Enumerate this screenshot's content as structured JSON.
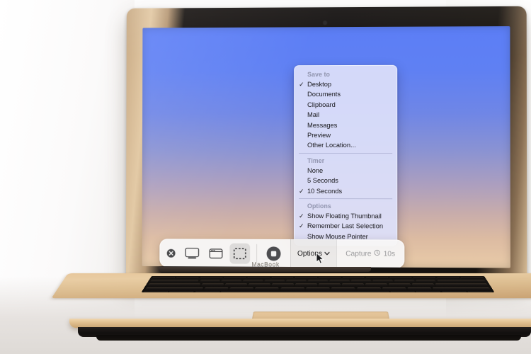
{
  "device": {
    "wordmark": "MacBook",
    "finish_color": "#e0bf94",
    "bezel_color": "#141110"
  },
  "wallpaper": {
    "top_color": "#5c7ef6",
    "bottom_color": "#e8cba9"
  },
  "popover": {
    "sections": [
      {
        "header": "Save to",
        "items": [
          {
            "label": "Desktop",
            "checked": true
          },
          {
            "label": "Documents",
            "checked": false
          },
          {
            "label": "Clipboard",
            "checked": false
          },
          {
            "label": "Mail",
            "checked": false
          },
          {
            "label": "Messages",
            "checked": false
          },
          {
            "label": "Preview",
            "checked": false
          },
          {
            "label": "Other Location...",
            "checked": false
          }
        ]
      },
      {
        "header": "Timer",
        "items": [
          {
            "label": "None",
            "checked": false
          },
          {
            "label": "5 Seconds",
            "checked": false
          },
          {
            "label": "10 Seconds",
            "checked": true
          }
        ]
      },
      {
        "header": "Options",
        "items": [
          {
            "label": "Show Floating Thumbnail",
            "checked": true
          },
          {
            "label": "Remember Last Selection",
            "checked": true
          },
          {
            "label": "Show Mouse Pointer",
            "checked": false
          }
        ]
      }
    ],
    "check_glyph": "✓"
  },
  "toolbar": {
    "close_icon": "close-icon",
    "capture_entire_screen_icon": "capture-entire-screen-icon",
    "capture_window_icon": "capture-selected-window-icon",
    "capture_selection_icon": "capture-selected-portion-icon",
    "record_selected_portion_icon": "record-selected-portion-icon",
    "options_label": "Options",
    "options_chevron": "⌄",
    "capture_label": "Capture",
    "timer_glyph": "◴",
    "timer_value": "10s",
    "selected_tool": "capture-selected-portion-icon"
  }
}
